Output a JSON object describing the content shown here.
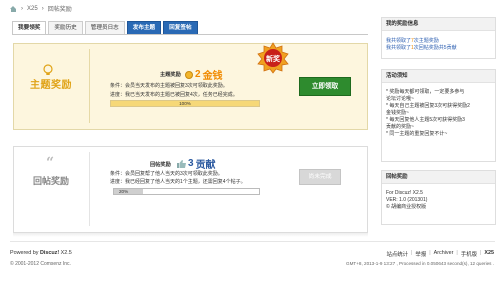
{
  "breadcrumb": {
    "site": "X25",
    "sep": "›",
    "current": "回帖奖励"
  },
  "tabs": [
    {
      "label": "我要领奖"
    },
    {
      "label": "奖励历史"
    },
    {
      "label": "管理员日志"
    },
    {
      "label": "发布主题"
    },
    {
      "label": "回复签帖"
    }
  ],
  "rewards": [
    {
      "title": "主题奖励",
      "name": "主题奖励",
      "reward_amount": "2",
      "reward_unit": "金钱",
      "condition": "条件：会员当天发布的主题被回复3次可领取此奖励。",
      "progress_text": "进度：我已当天发布的主题已被回复4次，任务已经完成。",
      "percent": 100,
      "percent_label": "100%",
      "badge": "新奖",
      "button": "立即领取"
    },
    {
      "title": "回帖奖励",
      "name": "回帖奖励",
      "reward_amount": "3",
      "reward_unit": "贡献",
      "condition": "条件：会员回复帮了他人当天的3次可领取此奖励。",
      "progress_text": "进度：我已经回复了他人当天的1个主题，还需回复4个帖子。",
      "percent": 20,
      "percent_label": "20%",
      "button": "尚未完成"
    }
  ],
  "sidebar": {
    "my_rewards": {
      "title": "我的奖励信息",
      "lines": [
        {
          "prefix": "我共领取了",
          "count": "7",
          "suffix": "次主题奖励"
        },
        {
          "prefix": "我共领取了",
          "count": "1",
          "suffix": "次回帖奖励共5贡献"
        }
      ]
    },
    "notice": {
      "title": "活动须知",
      "lines": [
        "* 奖励每天都可领取，一定要多参与",
        "论坛讨论哦~",
        "* 每天自己主题被回复3次可获得奖励2",
        "金钱奖励~",
        "* 每天回复他人主题5次可获得奖励3",
        "贡献的奖励~",
        "* 同一主题的重复回复不计~"
      ]
    },
    "info": {
      "title": "回帖奖励",
      "lines": [
        "For Discuz! X2.5",
        "VER: 1.0 (201301)",
        "© 胡编商业授权版"
      ]
    }
  },
  "footer": {
    "powered_prefix": "Powered by",
    "powered_brand": "Discuz!",
    "powered_version": "X2.5",
    "copyright": "© 2001-2012 Comsenz Inc.",
    "links": [
      "站点统计",
      "举报",
      "Archiver",
      "手机版",
      "X25"
    ],
    "gmt": "GMT+8, 2013-1-9 13:27 , Processed in 0.050643 second(s), 12 queries ."
  },
  "colors": {
    "accent_blue": "#2a6ab5",
    "claim_green": "#2e8b2e",
    "gold": "#f08a00"
  }
}
